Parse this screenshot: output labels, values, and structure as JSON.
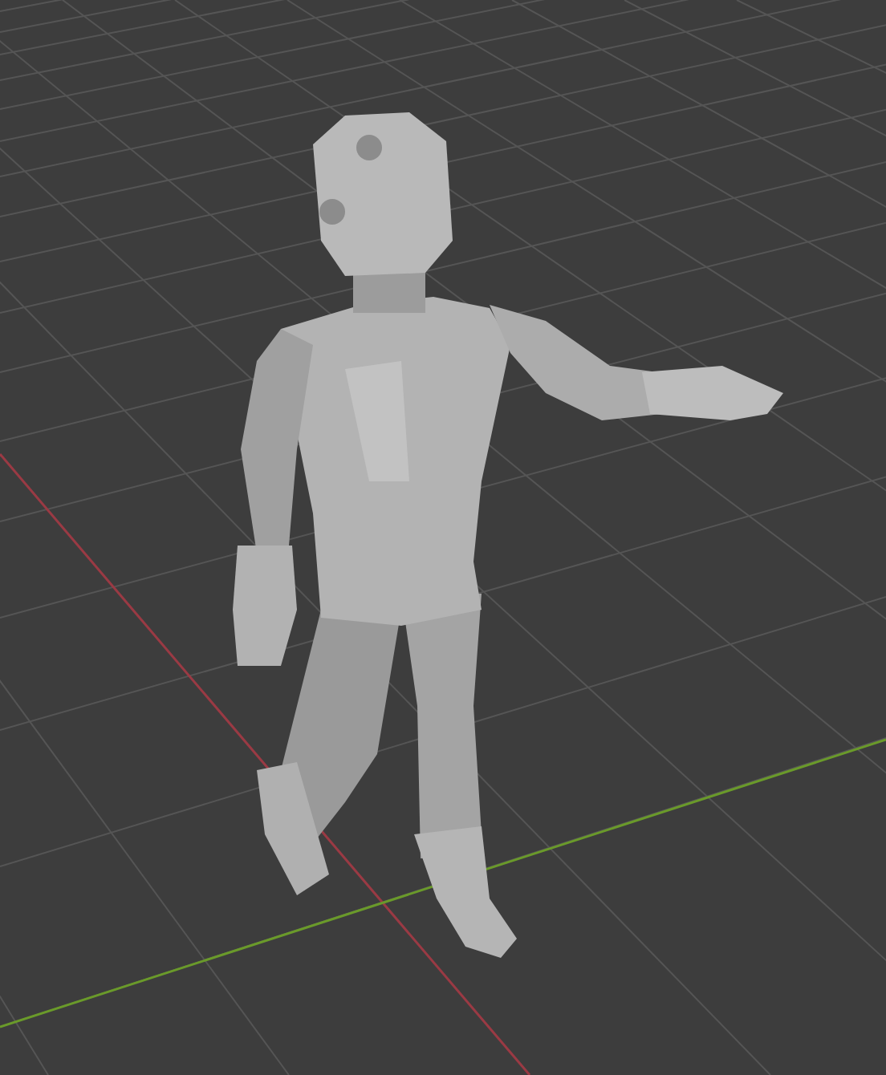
{
  "viewport": {
    "show_grid": true,
    "show_x_axis": true,
    "show_y_axis": true
  }
}
